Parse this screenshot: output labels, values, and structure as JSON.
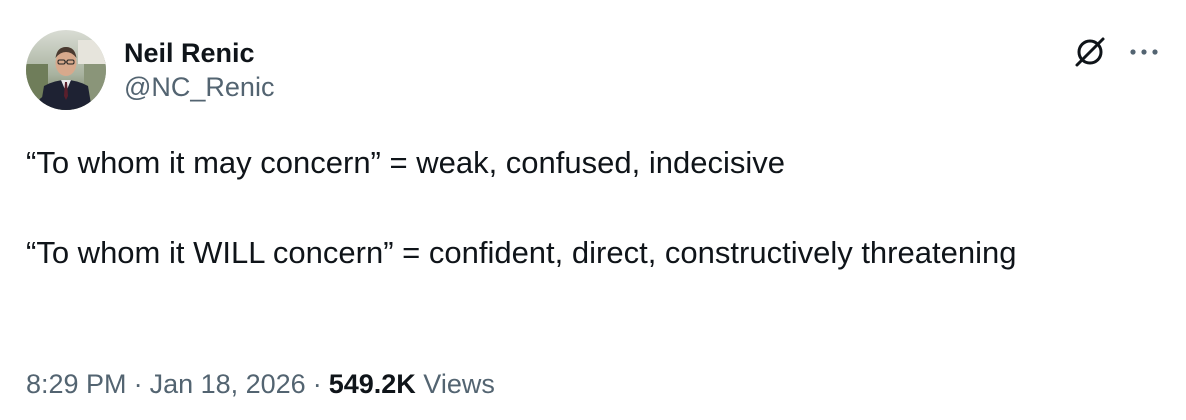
{
  "author": {
    "display_name": "Neil Renic",
    "handle": "@NC_Renic",
    "avatar_icon": "profile-photo"
  },
  "actions": {
    "grok_icon": "grok-icon",
    "more_icon": "more-horizontal-icon"
  },
  "tweet": {
    "paragraphs": [
      "“To whom it may concern” = weak, confused, indecisive",
      "“To whom it WILL concern” = confident, direct, constructively threatening"
    ]
  },
  "meta": {
    "time": "8:29 PM",
    "separator": "·",
    "date": "Jan 18, 2026",
    "views_count": "549.2K",
    "views_label": "Views"
  },
  "colors": {
    "text_primary": "#0f1419",
    "text_secondary": "#536471",
    "background": "#ffffff"
  }
}
